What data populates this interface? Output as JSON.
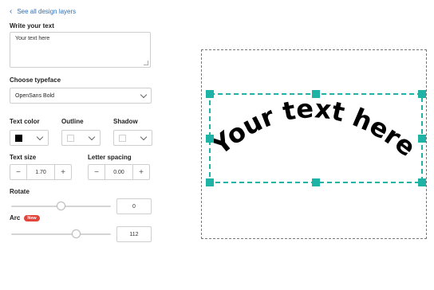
{
  "nav": {
    "back_label": "See all design layers"
  },
  "write_text": {
    "label": "Write your text",
    "value": "Your text here"
  },
  "typeface": {
    "label": "Choose typeface",
    "selected": "OpenSans Bold"
  },
  "colors": {
    "text_color_label": "Text color",
    "outline_label": "Outline",
    "shadow_label": "Shadow",
    "text_color_value": "#000000",
    "outline_value": "#ffffff",
    "shadow_value": "#ffffff"
  },
  "text_size": {
    "label": "Text size",
    "value": "1.70"
  },
  "letter_spacing": {
    "label": "Letter spacing",
    "value": "0.00"
  },
  "rotate": {
    "label": "Rotate",
    "value": "0",
    "slider_fraction": 0.5
  },
  "arc": {
    "label": "Arc",
    "badge": "New",
    "value": "112",
    "slider_fraction": 0.65
  },
  "preview": {
    "text": "Your text here",
    "handle_color": "#1fb3a6",
    "text_color": "#000000"
  },
  "icons": {
    "back": "chevron-left-icon",
    "dropdown": "chevron-down-icon",
    "minus": "minus-icon",
    "plus": "plus-icon"
  }
}
